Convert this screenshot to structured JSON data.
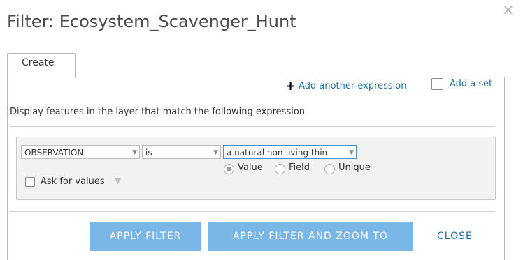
{
  "dialog": {
    "title": "Filter: Ecosystem_Scavenger_Hunt",
    "close_glyph": "×"
  },
  "tabs": [
    {
      "label": "Create",
      "active": true
    }
  ],
  "toolbar": {
    "add_expression_label": "Add another expression",
    "add_set_label": "Add a set",
    "add_set_checked": false
  },
  "description": "Display features in the layer that match the following expression",
  "expression": {
    "field": "OBSERVATION",
    "operator": "is",
    "value": "a natural non-living thin",
    "value_type_options": [
      {
        "label": "Value",
        "selected": true
      },
      {
        "label": "Field",
        "selected": false
      },
      {
        "label": "Unique",
        "selected": false
      }
    ],
    "ask_for_values_label": "Ask for values",
    "ask_for_values_checked": false
  },
  "buttons": {
    "apply_filter": "APPLY FILTER",
    "apply_filter_zoom": "APPLY FILTER AND ZOOM TO",
    "close": "CLOSE"
  },
  "colors": {
    "accent": "#7ab6e6",
    "link": "#1f6fa6"
  }
}
